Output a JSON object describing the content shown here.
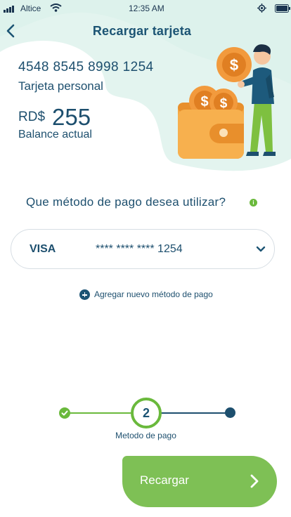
{
  "status_bar": {
    "carrier": "Altice",
    "time": "12:35 AM"
  },
  "header": {
    "title": "Recargar tarjeta"
  },
  "card": {
    "number": "4548 8545 8998 1254",
    "type": "Tarjeta personal",
    "currency": "RD$",
    "balance": "255",
    "balance_label": "Balance actual"
  },
  "payment": {
    "question": "Que método de pago desea utilizar?",
    "selected_brand": "VISA",
    "selected_number": "**** **** **** 1254",
    "add_new_label": "Agregar nuevo método de pago"
  },
  "stepper": {
    "current_step": "2",
    "current_label": "Metodo de pago"
  },
  "action": {
    "label": "Recargar"
  },
  "colors": {
    "primary": "#1d4f6e",
    "accent_green": "#6ab93c",
    "button_green": "#7ec055",
    "hero_background": "#e3f4ef",
    "coin": "#f29a3d"
  }
}
